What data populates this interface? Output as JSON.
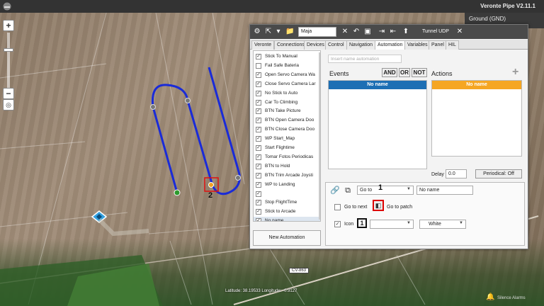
{
  "app": {
    "title": "Veronte Pipe V2.11.1",
    "ground_label": "Ground (GND)"
  },
  "map": {
    "road_label": "CV-863",
    "coords_text": "Latitude: 38.19533  Longitude: -0.9127",
    "alarm_label": "Silence Alarms",
    "callout_waypoint": "2"
  },
  "toolbar": {
    "name_value": "Maja",
    "tunnel_label": "Tunnel UDP"
  },
  "tabs": [
    {
      "label": "Veronte"
    },
    {
      "label": "Connections"
    },
    {
      "label": "Devices"
    },
    {
      "label": "Control"
    },
    {
      "label": "Navigation"
    },
    {
      "label": "Automation"
    },
    {
      "label": "Variables"
    },
    {
      "label": "Panel"
    },
    {
      "label": "HIL"
    }
  ],
  "automations": [
    {
      "label": "Stick To Manual",
      "checked": true
    },
    {
      "label": "Fail Safe Bateria",
      "checked": false
    },
    {
      "label": "Open Servo Camera Wa",
      "checked": true
    },
    {
      "label": "Close Servo Camera Lar",
      "checked": true
    },
    {
      "label": "No Stick to Auto",
      "checked": true
    },
    {
      "label": "Car To Climbing",
      "checked": true
    },
    {
      "label": "BTN Take Picture",
      "checked": true
    },
    {
      "label": "BTN Open Camera Doo",
      "checked": true
    },
    {
      "label": "BTN Close Camera Doo",
      "checked": true
    },
    {
      "label": "WP Start_Map",
      "checked": true
    },
    {
      "label": "Start Flightime",
      "checked": true
    },
    {
      "label": "Tomar Fotos Periodicas",
      "checked": true
    },
    {
      "label": "BTN to Hold",
      "checked": true
    },
    {
      "label": "BTN Trim Arcade Joysti",
      "checked": true
    },
    {
      "label": "WP to Landing",
      "checked": true
    },
    {
      "label": "",
      "checked": true
    },
    {
      "label": "Stop FlightTime",
      "checked": true
    },
    {
      "label": "Stick to Arcade",
      "checked": true
    },
    {
      "label": "No name",
      "checked": true
    }
  ],
  "new_automation_label": "New Automation",
  "automation_name_placeholder": "Insert name automation",
  "events": {
    "label": "Events",
    "head": "No name"
  },
  "logic": {
    "and": "AND",
    "or": "OR",
    "not": "NOT"
  },
  "actions": {
    "label": "Actions",
    "head": "No name",
    "add": "+"
  },
  "delay": {
    "label": "Delay",
    "value": "0.0"
  },
  "periodical_label": "Periodical: Off",
  "action_detail": {
    "goto_select": "Go to",
    "goto_target": "No name",
    "callout_1": "1",
    "go_to_next": "Go to next",
    "go_to_patch": "Go to patch",
    "icon_label": "Icon",
    "icon_value": "1",
    "color_value": "White"
  }
}
